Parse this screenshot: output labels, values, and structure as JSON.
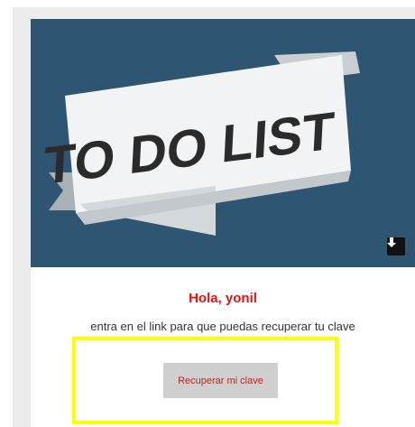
{
  "banner": {
    "title": "TO DO LIST",
    "background_color": "#2e5572",
    "download_icon": "download-arrow-icon"
  },
  "email": {
    "greeting": "Hola, yonil",
    "message": "entra en el link para que puedas recuperar tu clave",
    "button_label": "Recuperar mi clave",
    "greeting_color": "#e4120f",
    "highlight_color": "#ffff00"
  }
}
